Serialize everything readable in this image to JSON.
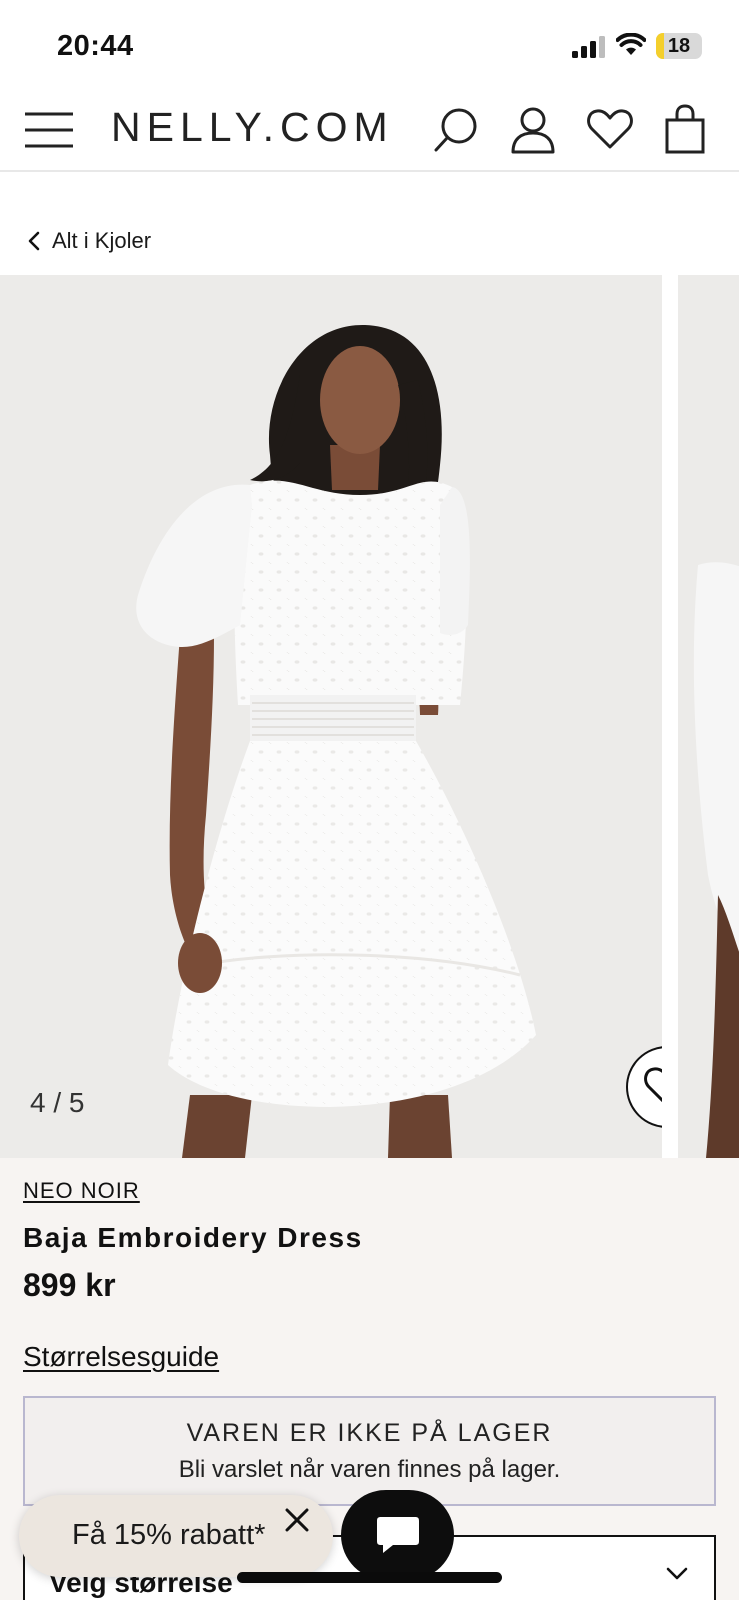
{
  "status_bar": {
    "time": "20:44",
    "battery_level": "18",
    "battery_fraction": 0.18,
    "battery_color": "#f4cf2c"
  },
  "nav": {
    "logo": "NELLY.COM",
    "icons": [
      "menu-icon",
      "search-icon",
      "account-icon",
      "wishlist-icon",
      "bag-icon"
    ]
  },
  "breadcrumb": {
    "label": "Alt i Kjoler",
    "icon": "chevron-left-icon"
  },
  "gallery": {
    "counter": "4 / 5",
    "background_color": "#ecebe9",
    "wishlist_icon": "heart-icon"
  },
  "product": {
    "brand": "NEO NOIR",
    "name": "Baja Embroidery Dress",
    "price": "899 kr"
  },
  "size_guide": {
    "label": "Størrelsesguide"
  },
  "stock_notice": {
    "title": "VAREN ER IKKE PÅ LAGER",
    "subtitle": "Bli varslet når varen finnes på lager.",
    "border_color": "#b9b7cf"
  },
  "size_select": {
    "label": "Velg størrelse"
  },
  "promo": {
    "text": "Få 15% rabatt*",
    "background_color": "#ece6df"
  },
  "chat": {
    "icon": "chat-bubble-icon"
  }
}
